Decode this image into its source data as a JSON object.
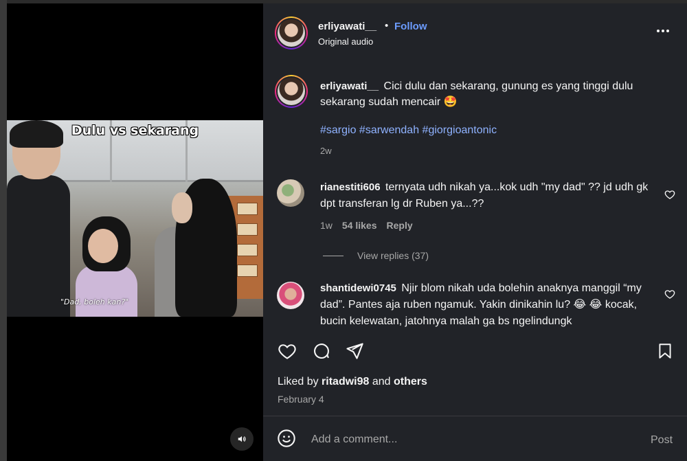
{
  "post": {
    "username": "erliyawati__",
    "dot": "•",
    "follow_label": "Follow",
    "audio_label": "Original audio"
  },
  "video": {
    "overlay_title": "Dulu vs sekarang",
    "subtitle": "\"Dad, boleh kan?\"",
    "mute_icon": "speaker-icon"
  },
  "caption": {
    "username": "erliyawati__",
    "text": "Cici dulu dan sekarang, gunung es yang tinggi dulu sekarang sudah mencair 🤩",
    "hashtags": "#sargio #sarwendah #giorgioantonic",
    "time": "2w"
  },
  "comments": [
    {
      "username": "rianestiti606",
      "text": "ternyata udh nikah ya...kok udh \"my dad\" ?? jd udh gk dpt transferan lg dr Ruben ya...??",
      "time": "1w",
      "likes": "54 likes",
      "reply_label": "Reply",
      "view_replies": "View replies (37)"
    },
    {
      "username": "shantidewi0745",
      "text": "Njir blom nikah uda bolehin anaknya manggil “my dad”. Pantes aja ruben ngamuk. Yakin dinikahin lu? 😂 😂 kocak, bucin kelewatan, jatohnya malah ga bs ngelindungk"
    }
  ],
  "engagement": {
    "liked_prefix": "Liked by",
    "liked_user": "ritadwi98",
    "liked_and": "and",
    "liked_others": "others",
    "date": "February 4"
  },
  "comment_box": {
    "placeholder": "Add a comment...",
    "post_label": "Post"
  },
  "colors": {
    "panel_bg": "#212328",
    "link_blue": "#6c9cff",
    "hashtag_blue": "#8fb2ff",
    "muted": "#a8a8a8"
  }
}
